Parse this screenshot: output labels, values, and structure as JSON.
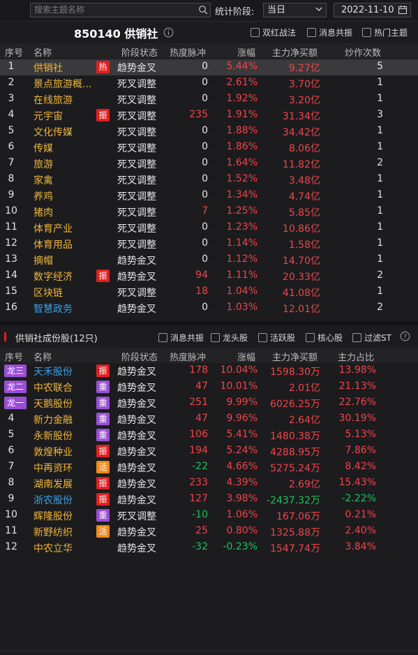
{
  "toolbar": {
    "search_placeholder": "搜索主题名称",
    "stat_label": "统计阶段:",
    "stat_value": "当日",
    "date_value": "2022-11-10"
  },
  "sector": {
    "title": "850140 供销社",
    "checkboxes": [
      "双红战法",
      "消息共振",
      "热门主题"
    ]
  },
  "table1": {
    "headers": [
      "序号",
      "名称",
      "阶段状态",
      "热度脉冲",
      "涨幅",
      "主力净买额",
      "炒作次数"
    ],
    "rows": [
      {
        "idx": "1",
        "name": "供销社",
        "tag": "热",
        "stage": "趋势金叉",
        "heat": "0",
        "pct": "5.44%",
        "net": "9.27亿",
        "times": "5"
      },
      {
        "idx": "2",
        "name": "景点旅游概...",
        "tag": "",
        "stage": "死叉调整",
        "heat": "0",
        "pct": "2.61%",
        "net": "3.70亿",
        "times": "1"
      },
      {
        "idx": "3",
        "name": "在线旅游",
        "tag": "",
        "stage": "死叉调整",
        "heat": "0",
        "pct": "1.92%",
        "net": "3.20亿",
        "times": "1"
      },
      {
        "idx": "4",
        "name": "元宇宙",
        "tag": "振",
        "stage": "死叉调整",
        "heat": "235",
        "pct": "1.91%",
        "net": "31.34亿",
        "times": "3"
      },
      {
        "idx": "5",
        "name": "文化传媒",
        "tag": "",
        "stage": "死叉调整",
        "heat": "0",
        "pct": "1.88%",
        "net": "34.42亿",
        "times": "1"
      },
      {
        "idx": "6",
        "name": "传媒",
        "tag": "",
        "stage": "死叉调整",
        "heat": "0",
        "pct": "1.86%",
        "net": "8.06亿",
        "times": "1"
      },
      {
        "idx": "7",
        "name": "旅游",
        "tag": "",
        "stage": "死叉调整",
        "heat": "0",
        "pct": "1.64%",
        "net": "11.82亿",
        "times": "2"
      },
      {
        "idx": "8",
        "name": "家禽",
        "tag": "",
        "stage": "死叉调整",
        "heat": "0",
        "pct": "1.52%",
        "net": "3.48亿",
        "times": "1"
      },
      {
        "idx": "9",
        "name": "养鸡",
        "tag": "",
        "stage": "死叉调整",
        "heat": "0",
        "pct": "1.34%",
        "net": "4.74亿",
        "times": "1"
      },
      {
        "idx": "10",
        "name": "猪肉",
        "tag": "",
        "stage": "死叉调整",
        "heat": "7",
        "pct": "1.25%",
        "net": "5.85亿",
        "times": "1"
      },
      {
        "idx": "11",
        "name": "体育产业",
        "tag": "",
        "stage": "死叉调整",
        "heat": "0",
        "pct": "1.23%",
        "net": "10.86亿",
        "times": "1"
      },
      {
        "idx": "12",
        "name": "体育用品",
        "tag": "",
        "stage": "死叉调整",
        "heat": "0",
        "pct": "1.14%",
        "net": "1.58亿",
        "times": "1"
      },
      {
        "idx": "13",
        "name": "摘帽",
        "tag": "",
        "stage": "趋势金叉",
        "heat": "0",
        "pct": "1.12%",
        "net": "14.70亿",
        "times": "1"
      },
      {
        "idx": "14",
        "name": "数字经济",
        "tag": "振",
        "stage": "趋势金叉",
        "heat": "94",
        "pct": "1.11%",
        "net": "20.33亿",
        "times": "2"
      },
      {
        "idx": "15",
        "name": "区块链",
        "tag": "",
        "stage": "死叉调整",
        "heat": "18",
        "pct": "1.04%",
        "net": "41.08亿",
        "times": "1"
      },
      {
        "idx": "16",
        "name": "智慧政务",
        "tag": "",
        "stage": "趋势金叉",
        "heat": "0",
        "pct": "1.03%",
        "net": "12.01亿",
        "times": "2"
      }
    ]
  },
  "section2": {
    "title": "供销社成份股(12只)",
    "checkboxes": [
      "消息共振",
      "龙头股",
      "活跃股",
      "核心股",
      "过滤ST"
    ]
  },
  "table2": {
    "headers": [
      "序号",
      "名称",
      "阶段状态",
      "热度脉冲",
      "涨幅",
      "主力净买额",
      "主力占比"
    ],
    "rows": [
      {
        "idx": "龙三",
        "name": "天禾股份",
        "tag": "振",
        "stage": "趋势金叉",
        "heat": "178",
        "pct": "10.04%",
        "net": "1598.30万",
        "ratio": "13.98%"
      },
      {
        "idx": "龙二",
        "name": "中农联合",
        "tag": "重",
        "stage": "趋势金叉",
        "heat": "47",
        "pct": "10.01%",
        "net": "2.01亿",
        "ratio": "21.13%"
      },
      {
        "idx": "龙一",
        "name": "天鹅股份",
        "tag": "重",
        "stage": "趋势金叉",
        "heat": "251",
        "pct": "9.99%",
        "net": "6026.25万",
        "ratio": "22.76%"
      },
      {
        "idx": "4",
        "name": "新力金融",
        "tag": "重",
        "stage": "趋势金叉",
        "heat": "47",
        "pct": "9.96%",
        "net": "2.64亿",
        "ratio": "30.19%"
      },
      {
        "idx": "5",
        "name": "永新股份",
        "tag": "重",
        "stage": "趋势金叉",
        "heat": "106",
        "pct": "5.41%",
        "net": "1480.38万",
        "ratio": "5.13%"
      },
      {
        "idx": "6",
        "name": "敦煌种业",
        "tag": "振",
        "stage": "趋势金叉",
        "heat": "194",
        "pct": "5.24%",
        "net": "4288.95万",
        "ratio": "7.86%"
      },
      {
        "idx": "7",
        "name": "中再资环",
        "tag": "活",
        "stage": "趋势金叉",
        "heat": "-22",
        "pct": "4.66%",
        "net": "5275.24万",
        "ratio": "8.42%"
      },
      {
        "idx": "8",
        "name": "湖南发展",
        "tag": "振",
        "stage": "趋势金叉",
        "heat": "233",
        "pct": "4.39%",
        "net": "2.69亿",
        "ratio": "15.43%"
      },
      {
        "idx": "9",
        "name": "浙农股份",
        "tag": "振",
        "stage": "趋势金叉",
        "heat": "127",
        "pct": "3.98%",
        "net": "-2437.32万",
        "ratio": "-2.22%"
      },
      {
        "idx": "10",
        "name": "辉隆股份",
        "tag": "重",
        "stage": "死叉调整",
        "heat": "-10",
        "pct": "1.06%",
        "net": "167.06万",
        "ratio": "0.21%"
      },
      {
        "idx": "11",
        "name": "新野纺织",
        "tag": "活",
        "stage": "趋势金叉",
        "heat": "25",
        "pct": "0.80%",
        "net": "1325.88万",
        "ratio": "2.40%"
      },
      {
        "idx": "12",
        "name": "中农立华",
        "tag": "",
        "stage": "趋势金叉",
        "heat": "-32",
        "pct": "-0.23%",
        "net": "1547.74万",
        "ratio": "3.84%"
      }
    ]
  },
  "colors": {
    "up": "#f0454a",
    "down": "#20c060",
    "name": "#f0b63c",
    "link": "#3aa0e8",
    "tag_red": "#e02020",
    "tag_purple": "#9a4ed6",
    "tag_orange": "#f08a1c"
  },
  "icons": [
    "search-icon",
    "chevron-down-icon",
    "calendar-icon",
    "info-icon",
    "help-icon"
  ]
}
